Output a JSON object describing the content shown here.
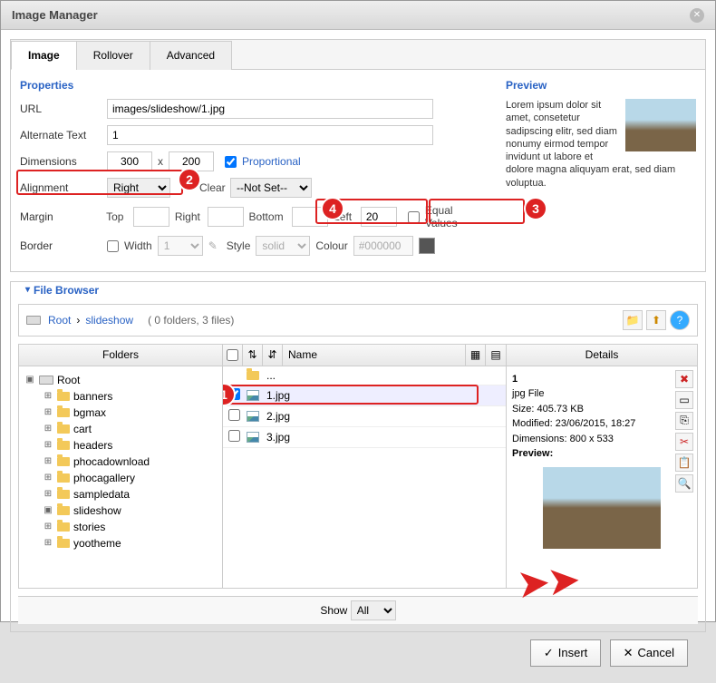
{
  "window": {
    "title": "Image Manager"
  },
  "tabs": [
    "Image",
    "Rollover",
    "Advanced"
  ],
  "active_tab": "Image",
  "properties": {
    "heading": "Properties",
    "url_label": "URL",
    "url": "images/slideshow/1.jpg",
    "alt_label": "Alternate Text",
    "alt": "1",
    "dim_label": "Dimensions",
    "width": "300",
    "x": "x",
    "height": "200",
    "proportional_label": "Proportional",
    "align_label": "Alignment",
    "align_value": "Right",
    "clear_label": "Clear",
    "clear_value": "--Not Set--",
    "margin_label": "Margin",
    "margin_top_label": "Top",
    "margin_right_label": "Right",
    "margin_bottom_label": "Bottom",
    "margin_left_label": "Left",
    "margin_left": "20",
    "equal_values_label": "Equal Values",
    "border_label": "Border",
    "border_width_label": "Width",
    "border_width": "1",
    "border_style_label": "Style",
    "border_style": "solid",
    "border_color_label": "Colour",
    "border_color": "#000000"
  },
  "preview": {
    "heading": "Preview",
    "text": "Lorem ipsum dolor sit amet, consetetur sadipscing elitr, sed diam nonumy eirmod tempor invidunt ut labore et dolore magna aliquyam erat, sed diam voluptua."
  },
  "filebrowser": {
    "heading": "File Browser",
    "root": "Root",
    "crumb_sep": "›",
    "current": "slideshow",
    "status": "( 0 folders, 3 files)",
    "folders_header": "Folders",
    "name_header": "Name",
    "details_header": "Details",
    "tree": [
      "banners",
      "bgmax",
      "cart",
      "headers",
      "phocadownload",
      "phocagallery",
      "sampledata",
      "slideshow",
      "stories",
      "yootheme"
    ],
    "parent_dir": "...",
    "files": [
      "1.jpg",
      "2.jpg",
      "3.jpg"
    ],
    "selected_file": "1.jpg",
    "show_label": "Show",
    "show_value": "All",
    "details": {
      "name": "1",
      "type": "jpg File",
      "size_label": "Size:",
      "size": "405.73 KB",
      "modified_label": "Modified:",
      "modified": "23/06/2015, 18:27",
      "dims_label": "Dimensions:",
      "dims": "800 x 533",
      "preview_label": "Preview:"
    }
  },
  "buttons": {
    "insert": "Insert",
    "cancel": "Cancel"
  },
  "annotations": {
    "b1": "1",
    "b2": "2",
    "b3": "3",
    "b4": "4"
  }
}
